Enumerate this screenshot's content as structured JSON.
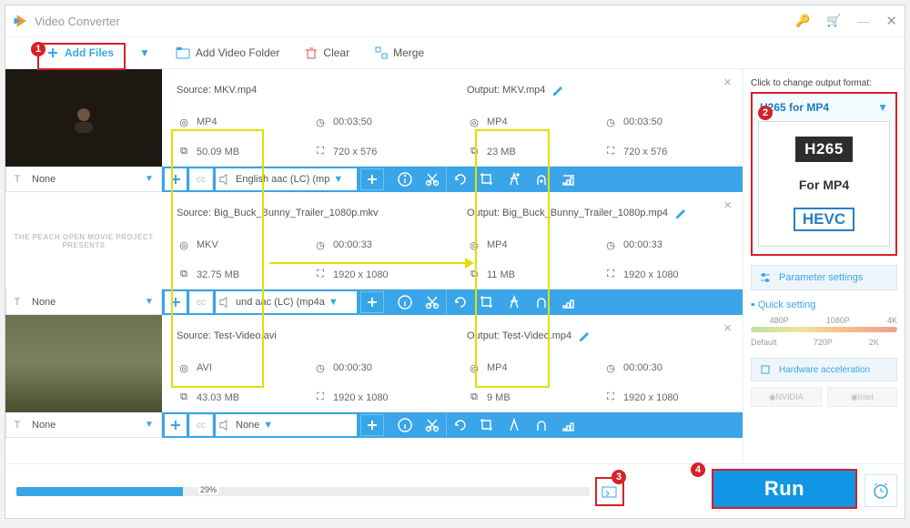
{
  "title": "Video Converter",
  "toolbar": {
    "add_files": "Add Files",
    "add_folder": "Add Video Folder",
    "clear": "Clear",
    "merge": "Merge"
  },
  "strip": {
    "subtitle": "None"
  },
  "rows": [
    {
      "source_label": "Source: MKV.mp4",
      "output_label": "Output: MKV.mp4",
      "src_container": "MP4",
      "src_duration": "00:03:50",
      "src_size": "50.09 MB",
      "src_dims": "720 x 576",
      "out_container": "MP4",
      "out_duration": "00:03:50",
      "out_size": "23 MB",
      "out_dims": "720 x 576",
      "audio_track": "English aac (LC) (mp"
    },
    {
      "source_label": "Source: Big_Buck_Bunny_Trailer_1080p.mkv",
      "output_label": "Output: Big_Buck_Bunny_Trailer_1080p.mp4",
      "src_container": "MKV",
      "src_duration": "00:00:33",
      "src_size": "32.75 MB",
      "src_dims": "1920 x 1080",
      "out_container": "MP4",
      "out_duration": "00:00:33",
      "out_size": "11 MB",
      "out_dims": "1920 x 1080",
      "audio_track": "und aac (LC) (mp4a"
    },
    {
      "source_label": "Source: Test-Video.avi",
      "output_label": "Output: Test-Video.mp4",
      "src_container": "AVI",
      "src_duration": "00:00:30",
      "src_size": "43.03 MB",
      "src_dims": "1920 x 1080",
      "out_container": "MP4",
      "out_duration": "00:00:30",
      "out_size": "9 MB",
      "out_dims": "1920 x 1080",
      "audio_track": "None"
    }
  ],
  "side": {
    "hint": "Click to change output format:",
    "format_name": "H265 for MP4",
    "card_top": "H265",
    "card_mid": "For MP4",
    "card_low": "HEVC",
    "param": "Parameter settings",
    "quick": "Quick setting",
    "scale": [
      "Default",
      "480P",
      "720P",
      "1080P",
      "2K",
      "4K"
    ],
    "hw": "Hardware acceleration",
    "nvidia": "NVIDIA",
    "intel": "Intel"
  },
  "bottom": {
    "progress_pct": "29%",
    "run": "Run"
  },
  "thumb2_text": "THE PEACH OPEN MOVIE PROJECT\nPRESENTS"
}
